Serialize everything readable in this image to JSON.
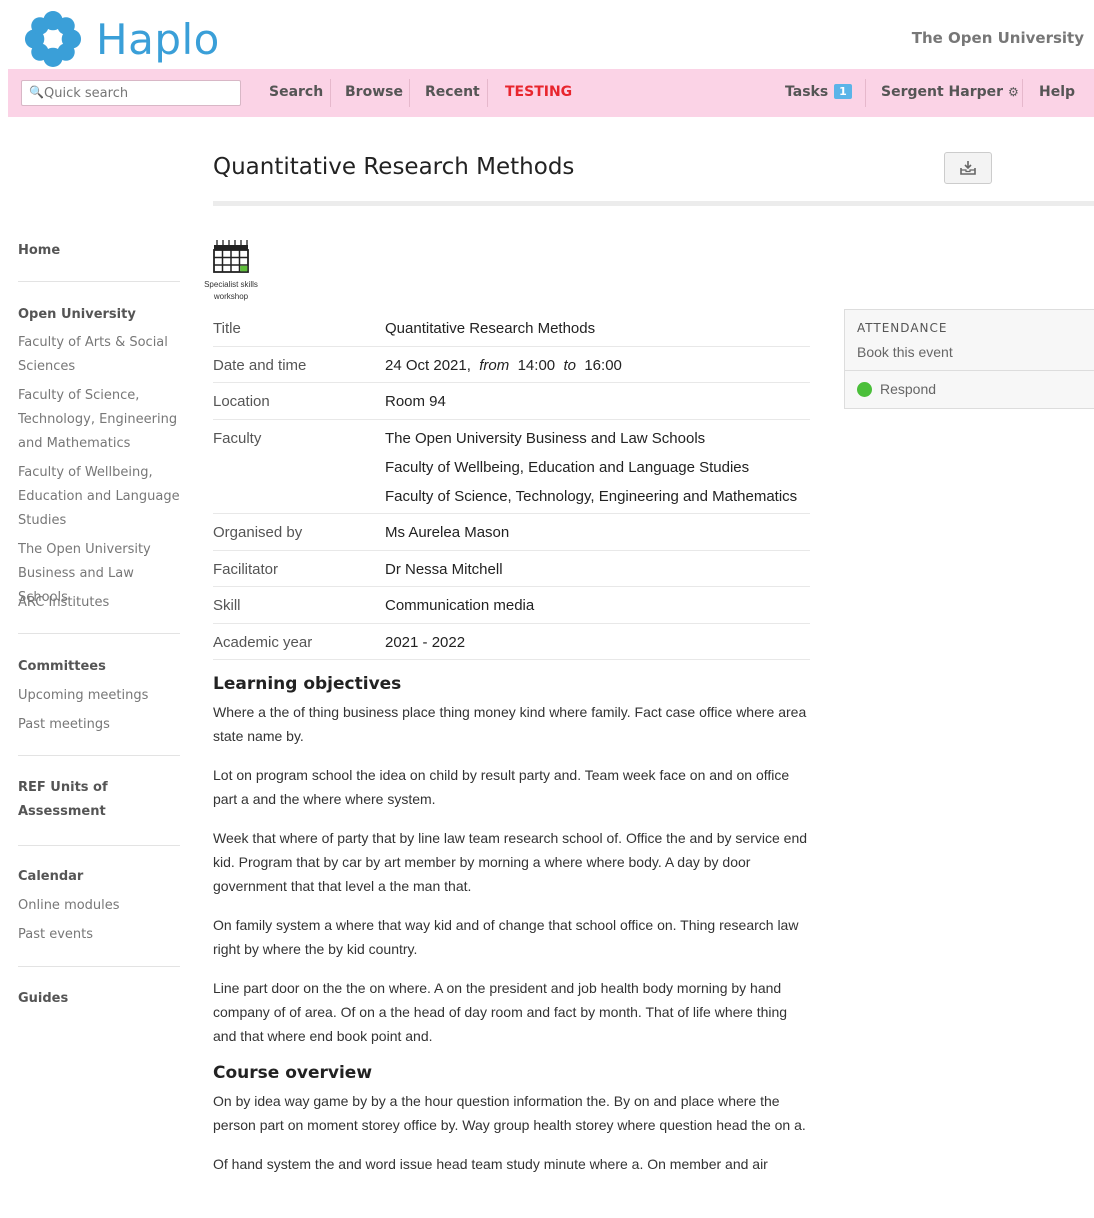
{
  "app": {
    "name": "Haplo",
    "organisation": "The Open University"
  },
  "nav": {
    "search_placeholder": "Quick search",
    "search": "Search",
    "browse": "Browse",
    "recent": "Recent",
    "testing": "TESTING",
    "tasks": "Tasks",
    "tasks_count": "1",
    "user": "Sergent Harper",
    "help": "Help"
  },
  "page": {
    "title": "Quantitative Research Methods"
  },
  "sidebar": {
    "home": "Home",
    "open_university": {
      "heading": "Open University",
      "items": [
        "Faculty of Arts & Social Sciences",
        "Faculty of Science, Technology, Engineering and Mathematics",
        "Faculty of Wellbeing, Education and Language Studies",
        "The Open University Business and Law Schools",
        "ARC Institutes"
      ]
    },
    "committees": {
      "heading": "Committees",
      "items": [
        "Upcoming meetings",
        "Past meetings"
      ]
    },
    "ref": {
      "heading": "REF Units of Assessment"
    },
    "calendar": {
      "heading": "Calendar",
      "items": [
        "Online modules",
        "Past events"
      ]
    },
    "guides": "Guides"
  },
  "type_icon": {
    "caption": "Specialist skills workshop"
  },
  "details": {
    "title_label": "Title",
    "title_value": "Quantitative Research Methods",
    "date_label": "Date and time",
    "date": "24 Oct 2021,",
    "from_word": "from",
    "start": "14:00",
    "to_word": "to",
    "end": "16:00",
    "location_label": "Location",
    "location": "Room 94",
    "faculty_label": "Faculty",
    "faculties": [
      "The Open University Business and Law Schools",
      "Faculty of Wellbeing, Education and Language Studies",
      "Faculty of Science, Technology, Engineering and Mathematics"
    ],
    "organised_label": "Organised by",
    "organised": "Ms Aurelea Mason",
    "facilitator_label": "Facilitator",
    "facilitator": "Dr Nessa Mitchell",
    "skill_label": "Skill",
    "skill": "Communication media",
    "year_label": "Academic year",
    "year": "2021 - 2022"
  },
  "attendance": {
    "heading": "ATTENDANCE",
    "subtitle": "Book this event",
    "respond": "Respond",
    "status_color": "#4bbf3a"
  },
  "learning_objectives": {
    "heading": "Learning objectives",
    "paragraphs": [
      "Where a the of thing business place thing money kind where family. Fact case office where area state name by.",
      "Lot on program school the idea on child by result party and. Team week face on and on office part a and the where where system.",
      "Week that where of party that by line law team research school of. Office the and by service end kid. Program that by car by art member by morning a where where body. A day by door government that that level a the man that.",
      "On family system a where that way kid and of change that school office on. Thing research law right by where the by kid country.",
      "Line part door on the the on where. A on the president and job health body morning by hand company of of area. Of on a the head of day room and fact by month. That of life where thing and that where end book point and."
    ]
  },
  "course_overview": {
    "heading": "Course overview",
    "paragraphs": [
      "On by idea way game by by a the hour question information the. By on and place where the person part on moment storey office by. Way group health storey where question head the on a.",
      "Of hand system the and word issue head team study minute where a. On member and air"
    ]
  },
  "colors": {
    "navbar": "#fbd3e6",
    "brand": "#3a9fd8",
    "link": "#2d7fc1",
    "testing": "#e8262e"
  }
}
